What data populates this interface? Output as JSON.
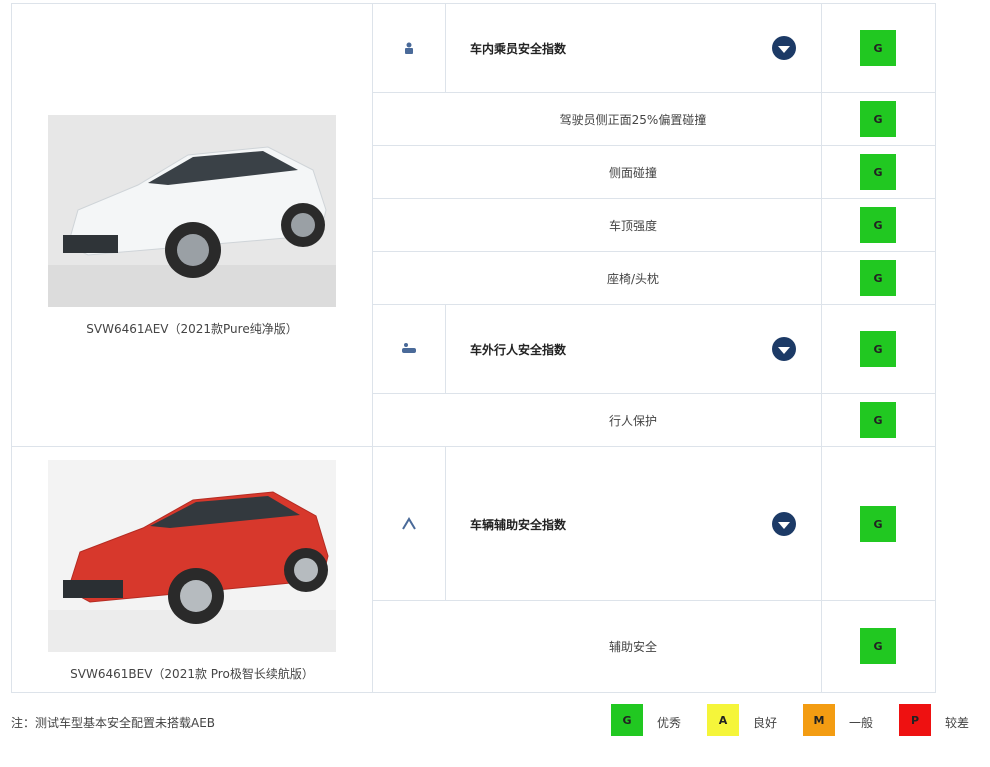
{
  "vehicles": [
    {
      "caption": "SVW6461AEV（2021款Pure纯净版）",
      "image_alt": "white SUV"
    },
    {
      "caption": "SVW6461BEV（2021款 Pro极智长续航版）",
      "image_alt": "red SUV"
    }
  ],
  "rows": [
    {
      "label": "车内乘员安全指数",
      "rating": "G",
      "icon": "passenger-seat-icon"
    },
    {
      "label": "驾驶员侧正面25%偏置碰撞",
      "rating": "G"
    },
    {
      "label": "侧面碰撞",
      "rating": "G"
    },
    {
      "label": "车顶强度",
      "rating": "G"
    },
    {
      "label": "座椅/头枕",
      "rating": "G"
    },
    {
      "label": "车外行人安全指数",
      "rating": "G",
      "icon": "pedestrian-icon"
    },
    {
      "label": "行人保护",
      "rating": "G"
    },
    {
      "label": "车辆辅助安全指数",
      "rating": "G",
      "icon": "assist-safety-icon"
    },
    {
      "label": "辅助安全",
      "rating": "G"
    }
  ],
  "note": "注：测试车型基本安全配置未搭载AEB",
  "legend": [
    {
      "code": "G",
      "label": "优秀",
      "color": "#21c821"
    },
    {
      "code": "A",
      "label": "良好",
      "color": "#f5f53a"
    },
    {
      "code": "M",
      "label": "一般",
      "color": "#f39c12"
    },
    {
      "code": "P",
      "label": "较差",
      "color": "#ee1111"
    }
  ],
  "colors": {
    "good": "#21c821",
    "chevron": "#1c3a66",
    "grid": "#dde3ea"
  }
}
